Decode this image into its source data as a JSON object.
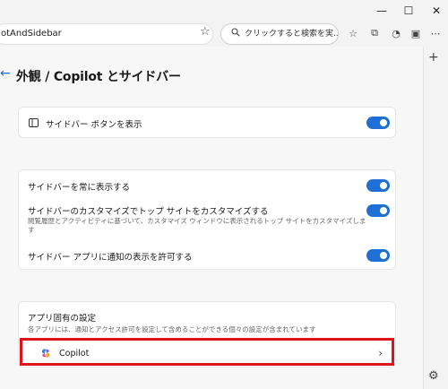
{
  "window": {
    "minimize_glyph": "—",
    "maximize_glyph": "☐",
    "close_glyph": "✕"
  },
  "toolbar": {
    "address_text": "otAndSidebar",
    "search_placeholder": "クリックすると検索を実...",
    "icons": [
      "star-icon",
      "search-icon",
      "favorites-icon",
      "collections-icon",
      "profile-icon",
      "sidebar-toggle-icon",
      "more-icon"
    ]
  },
  "page": {
    "back_glyph": "←",
    "title": "外観 / Copilot とサイドバー"
  },
  "card1": {
    "show_sidebar_button": "サイドバー ボタンを表示"
  },
  "card2": {
    "always_show": "サイドバーを常に表示する",
    "customize_top_sites": "サイドバーのカスタマイズでトップ サイトをカスタマイズする",
    "customize_top_sites_desc": "閲覧履歴とアクティビティに基づいて、カスタマイズ ウィンドウに表示されるトップ サイトをカスタマイズしま す",
    "allow_notifications": "サイドバー アプリに通知の表示を許可する"
  },
  "card3": {
    "heading": "アプリ固有の設定",
    "description": "各アプリには、通知とアクセス許可を設定して含めることができる個々の設定が含まれています",
    "copilot_label": "Copilot",
    "chevron": "›"
  },
  "sidebar": {
    "plus_glyph": "+",
    "gear_glyph": "⚙"
  },
  "colors": {
    "accent": "#1f6fd6",
    "highlight": "#e0121b"
  }
}
